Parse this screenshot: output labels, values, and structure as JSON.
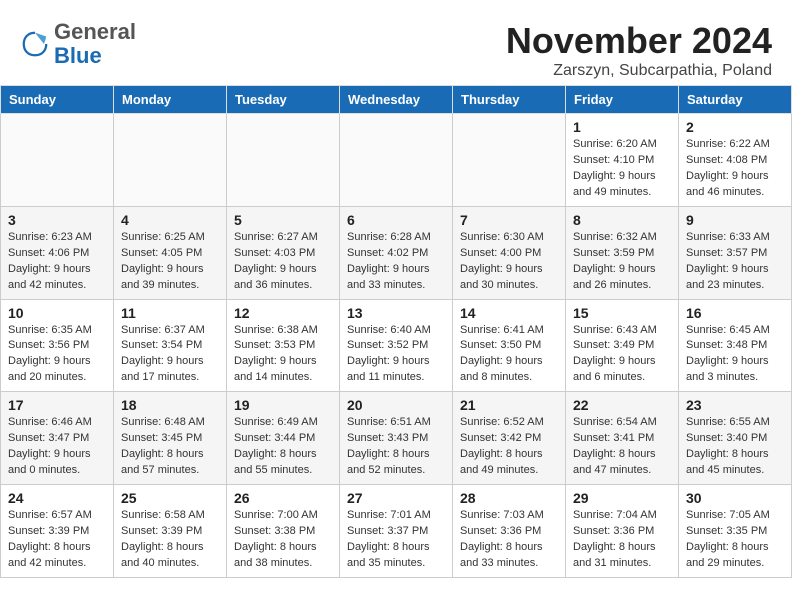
{
  "logo": {
    "general": "General",
    "blue": "Blue"
  },
  "header": {
    "month": "November 2024",
    "location": "Zarszyn, Subcarpathia, Poland"
  },
  "weekdays": [
    "Sunday",
    "Monday",
    "Tuesday",
    "Wednesday",
    "Thursday",
    "Friday",
    "Saturday"
  ],
  "weeks": [
    [
      {
        "day": "",
        "info": ""
      },
      {
        "day": "",
        "info": ""
      },
      {
        "day": "",
        "info": ""
      },
      {
        "day": "",
        "info": ""
      },
      {
        "day": "",
        "info": ""
      },
      {
        "day": "1",
        "info": "Sunrise: 6:20 AM\nSunset: 4:10 PM\nDaylight: 9 hours and 49 minutes."
      },
      {
        "day": "2",
        "info": "Sunrise: 6:22 AM\nSunset: 4:08 PM\nDaylight: 9 hours and 46 minutes."
      }
    ],
    [
      {
        "day": "3",
        "info": "Sunrise: 6:23 AM\nSunset: 4:06 PM\nDaylight: 9 hours and 42 minutes."
      },
      {
        "day": "4",
        "info": "Sunrise: 6:25 AM\nSunset: 4:05 PM\nDaylight: 9 hours and 39 minutes."
      },
      {
        "day": "5",
        "info": "Sunrise: 6:27 AM\nSunset: 4:03 PM\nDaylight: 9 hours and 36 minutes."
      },
      {
        "day": "6",
        "info": "Sunrise: 6:28 AM\nSunset: 4:02 PM\nDaylight: 9 hours and 33 minutes."
      },
      {
        "day": "7",
        "info": "Sunrise: 6:30 AM\nSunset: 4:00 PM\nDaylight: 9 hours and 30 minutes."
      },
      {
        "day": "8",
        "info": "Sunrise: 6:32 AM\nSunset: 3:59 PM\nDaylight: 9 hours and 26 minutes."
      },
      {
        "day": "9",
        "info": "Sunrise: 6:33 AM\nSunset: 3:57 PM\nDaylight: 9 hours and 23 minutes."
      }
    ],
    [
      {
        "day": "10",
        "info": "Sunrise: 6:35 AM\nSunset: 3:56 PM\nDaylight: 9 hours and 20 minutes."
      },
      {
        "day": "11",
        "info": "Sunrise: 6:37 AM\nSunset: 3:54 PM\nDaylight: 9 hours and 17 minutes."
      },
      {
        "day": "12",
        "info": "Sunrise: 6:38 AM\nSunset: 3:53 PM\nDaylight: 9 hours and 14 minutes."
      },
      {
        "day": "13",
        "info": "Sunrise: 6:40 AM\nSunset: 3:52 PM\nDaylight: 9 hours and 11 minutes."
      },
      {
        "day": "14",
        "info": "Sunrise: 6:41 AM\nSunset: 3:50 PM\nDaylight: 9 hours and 8 minutes."
      },
      {
        "day": "15",
        "info": "Sunrise: 6:43 AM\nSunset: 3:49 PM\nDaylight: 9 hours and 6 minutes."
      },
      {
        "day": "16",
        "info": "Sunrise: 6:45 AM\nSunset: 3:48 PM\nDaylight: 9 hours and 3 minutes."
      }
    ],
    [
      {
        "day": "17",
        "info": "Sunrise: 6:46 AM\nSunset: 3:47 PM\nDaylight: 9 hours and 0 minutes."
      },
      {
        "day": "18",
        "info": "Sunrise: 6:48 AM\nSunset: 3:45 PM\nDaylight: 8 hours and 57 minutes."
      },
      {
        "day": "19",
        "info": "Sunrise: 6:49 AM\nSunset: 3:44 PM\nDaylight: 8 hours and 55 minutes."
      },
      {
        "day": "20",
        "info": "Sunrise: 6:51 AM\nSunset: 3:43 PM\nDaylight: 8 hours and 52 minutes."
      },
      {
        "day": "21",
        "info": "Sunrise: 6:52 AM\nSunset: 3:42 PM\nDaylight: 8 hours and 49 minutes."
      },
      {
        "day": "22",
        "info": "Sunrise: 6:54 AM\nSunset: 3:41 PM\nDaylight: 8 hours and 47 minutes."
      },
      {
        "day": "23",
        "info": "Sunrise: 6:55 AM\nSunset: 3:40 PM\nDaylight: 8 hours and 45 minutes."
      }
    ],
    [
      {
        "day": "24",
        "info": "Sunrise: 6:57 AM\nSunset: 3:39 PM\nDaylight: 8 hours and 42 minutes."
      },
      {
        "day": "25",
        "info": "Sunrise: 6:58 AM\nSunset: 3:39 PM\nDaylight: 8 hours and 40 minutes."
      },
      {
        "day": "26",
        "info": "Sunrise: 7:00 AM\nSunset: 3:38 PM\nDaylight: 8 hours and 38 minutes."
      },
      {
        "day": "27",
        "info": "Sunrise: 7:01 AM\nSunset: 3:37 PM\nDaylight: 8 hours and 35 minutes."
      },
      {
        "day": "28",
        "info": "Sunrise: 7:03 AM\nSunset: 3:36 PM\nDaylight: 8 hours and 33 minutes."
      },
      {
        "day": "29",
        "info": "Sunrise: 7:04 AM\nSunset: 3:36 PM\nDaylight: 8 hours and 31 minutes."
      },
      {
        "day": "30",
        "info": "Sunrise: 7:05 AM\nSunset: 3:35 PM\nDaylight: 8 hours and 29 minutes."
      }
    ]
  ]
}
